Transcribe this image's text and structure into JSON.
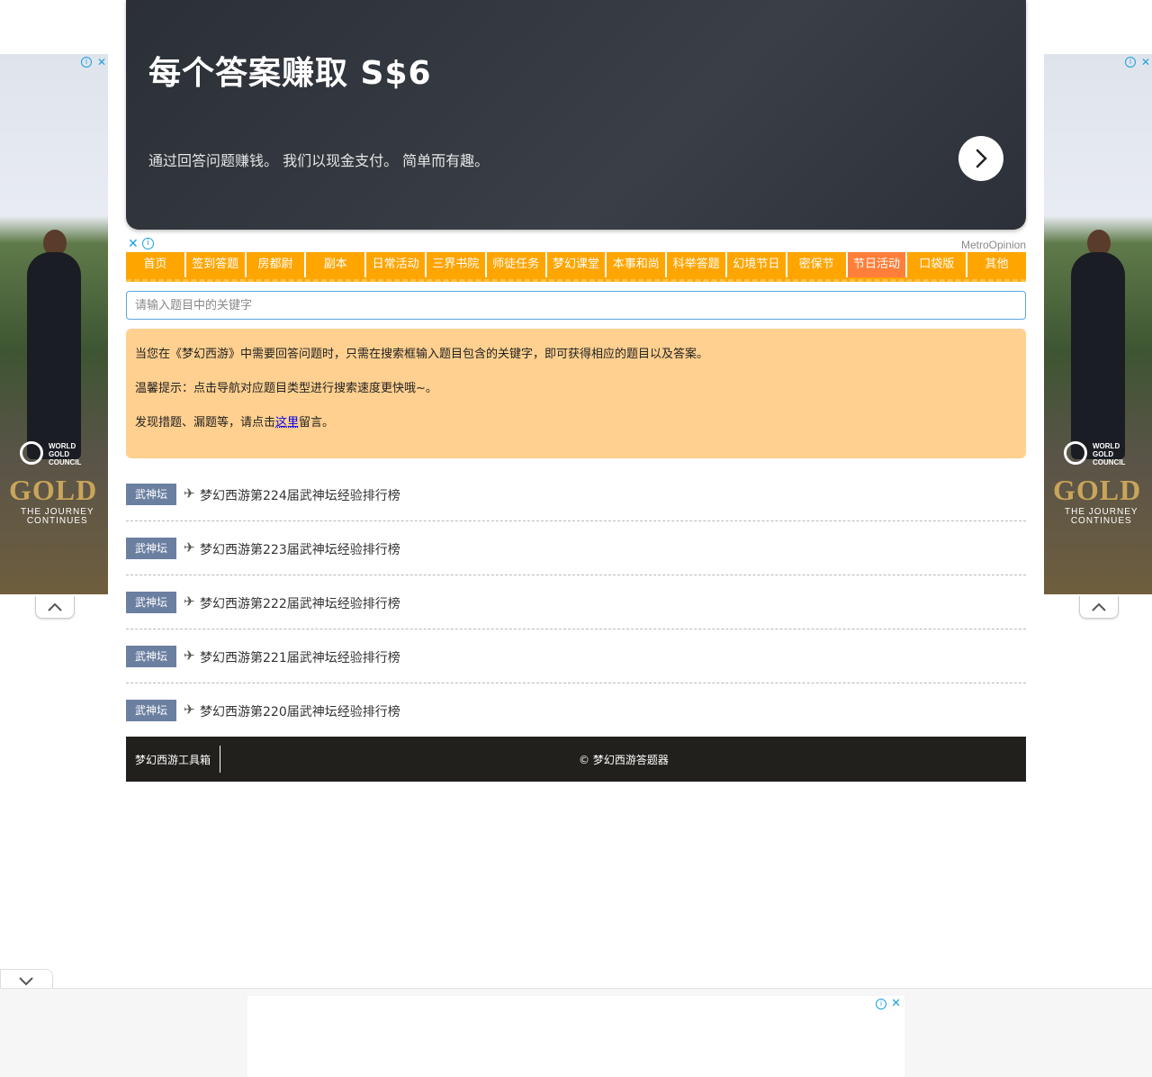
{
  "top_ad": {
    "headline": "每个答案赚取 S$6",
    "text": "通过回答问题赚钱。 我们以现金支付。 简单而有趣。",
    "brand": "MetroOpinion",
    "close_symbol": "✕",
    "info_symbol": "i"
  },
  "nav": {
    "items": [
      "首页",
      "签到答题",
      "房都尉",
      "副本",
      "日常活动",
      "三界书院",
      "师徒任务",
      "梦幻课堂",
      "本事和尚",
      "科举答题",
      "幻境节日",
      "密保节",
      "节日活动",
      "口袋版",
      "其他"
    ],
    "active_index": 12
  },
  "search": {
    "placeholder": "请输入题目中的关键字",
    "value": ""
  },
  "notice": {
    "line1": "当您在《梦幻西游》中需要回答问题时，只需在搜索框输入题目包含的关键字，即可获得相应的题目以及答案。",
    "line2": "温馨提示：点击导航对应题目类型进行搜索速度更快哦~。",
    "line3_before": "发现措题、漏题等，请点击",
    "line3_link": "这里",
    "line3_after": "留言。"
  },
  "list": {
    "items": [
      {
        "tag": "武神坛",
        "title": "梦幻西游第224届武神坛经验排行榜"
      },
      {
        "tag": "武神坛",
        "title": "梦幻西游第223届武神坛经验排行榜"
      },
      {
        "tag": "武神坛",
        "title": "梦幻西游第222届武神坛经验排行榜"
      },
      {
        "tag": "武神坛",
        "title": "梦幻西游第221届武神坛经验排行榜"
      },
      {
        "tag": "武神坛",
        "title": "梦幻西游第220届武神坛经验排行榜"
      }
    ],
    "bullet_icon": "✈"
  },
  "footer": {
    "brand": "梦幻西游工具箱",
    "copyright": "© 梦幻西游答题器"
  },
  "side_ad": {
    "org": "WORLD\nGOLD\nCOUNCIL",
    "word": "GOLD",
    "sub": "THE JOURNEY\nCONTINUES"
  },
  "colors": {
    "nav_bg": "#ffa500",
    "nav_active": "#ff7f3a",
    "notice_bg": "#ffd08f",
    "tag_bg": "#6b7fa0",
    "footer_bg": "#21201c"
  }
}
